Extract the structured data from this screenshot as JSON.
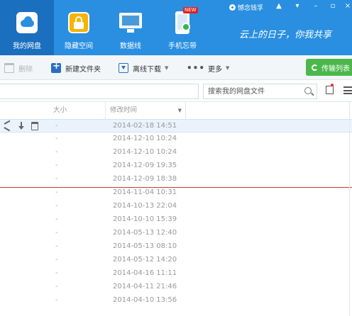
{
  "header": {
    "nav": [
      {
        "label": "我的网盘",
        "icon": "cloud-drive-icon",
        "active": true
      },
      {
        "label": "隐藏空间",
        "icon": "lock-icon",
        "active": false
      },
      {
        "label": "数据线",
        "icon": "monitor-phone-icon",
        "active": false
      },
      {
        "label": "手机忘带",
        "icon": "phone-icon",
        "active": false,
        "badge": "NEW"
      }
    ],
    "tagline": "云上的日子，你我共享",
    "user": {
      "name": "憾念钱孚"
    },
    "accent_color": "#2a8fe0"
  },
  "toolbar": {
    "delete_label": "删除",
    "new_folder_label": "新建文件夹",
    "offline_download_label": "离线下载",
    "more_label": "更多",
    "transfer_list_label": "传输列表"
  },
  "search": {
    "placeholder": "搜索我的网盘文件"
  },
  "columns": {
    "size": "大小",
    "modified": "修改时间"
  },
  "files": [
    {
      "size": "-",
      "modified": "2014-02-18 14:51"
    },
    {
      "size": "-",
      "modified": "2014-12-10 10:24"
    },
    {
      "size": "-",
      "modified": "2014-12-10 10:24"
    },
    {
      "size": "-",
      "modified": "2014-12-09 19:35"
    },
    {
      "size": "-",
      "modified": "2014-12-09 18:38"
    },
    {
      "size": "-",
      "modified": "2014-11-04 10:31"
    },
    {
      "size": "-",
      "modified": "2014-10-13 22:04"
    },
    {
      "size": "-",
      "modified": "2014-10-10 15:39"
    },
    {
      "size": "-",
      "modified": "2014-05-13 12:40"
    },
    {
      "size": "-",
      "modified": "2014-05-13 08:10"
    },
    {
      "size": "-",
      "modified": "2014-05-12 14:20"
    },
    {
      "size": "-",
      "modified": "2014-04-16 11:11"
    },
    {
      "size": "-",
      "modified": "2014-04-11 21:46"
    },
    {
      "size": "-",
      "modified": "2014-04-10 13:56"
    }
  ]
}
